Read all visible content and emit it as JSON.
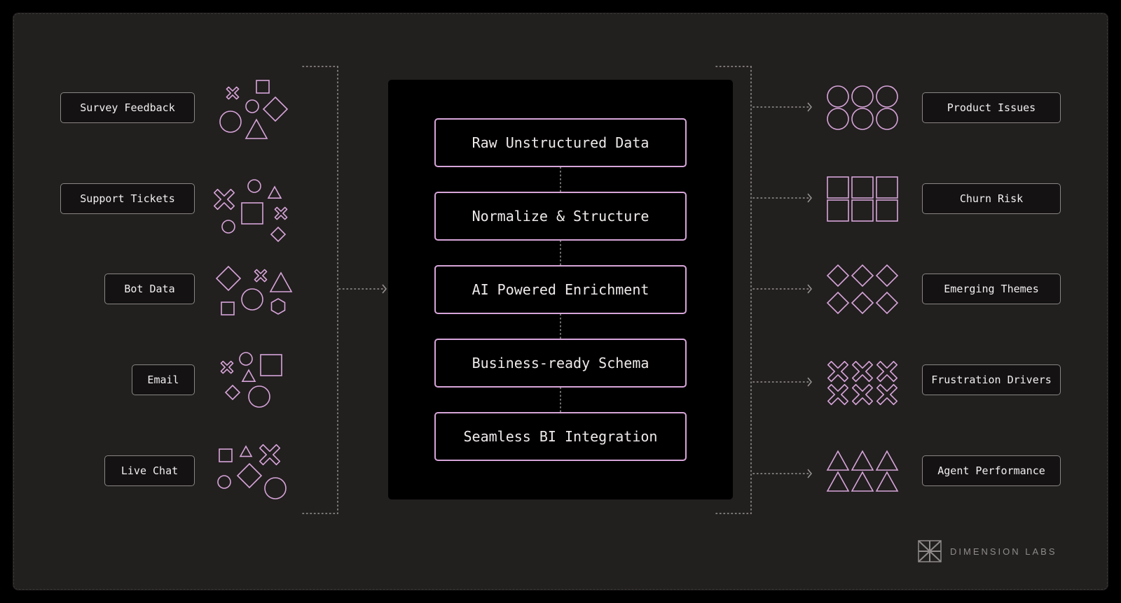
{
  "inputs": [
    {
      "label": "Survey Feedback"
    },
    {
      "label": "Support Tickets"
    },
    {
      "label": "Bot Data"
    },
    {
      "label": "Email"
    },
    {
      "label": "Live Chat"
    }
  ],
  "pipeline": [
    {
      "label": "Raw Unstructured Data"
    },
    {
      "label": "Normalize & Structure"
    },
    {
      "label": "AI Powered Enrichment"
    },
    {
      "label": "Business-ready Schema"
    },
    {
      "label": "Seamless BI Integration"
    }
  ],
  "outputs": [
    {
      "label": "Product Issues",
      "shape": "circle"
    },
    {
      "label": "Churn Risk",
      "shape": "square"
    },
    {
      "label": "Emerging Themes",
      "shape": "diamond"
    },
    {
      "label": "Frustration Drivers",
      "shape": "cross"
    },
    {
      "label": "Agent Performance",
      "shape": "triangle"
    }
  ],
  "brand": {
    "name": "DIMENSION LABS"
  },
  "colors": {
    "background": "#000000",
    "panel": "#221f1f",
    "accent": "#d7a5d9",
    "label_border": "#8a8585",
    "connector": "#9a9595"
  }
}
